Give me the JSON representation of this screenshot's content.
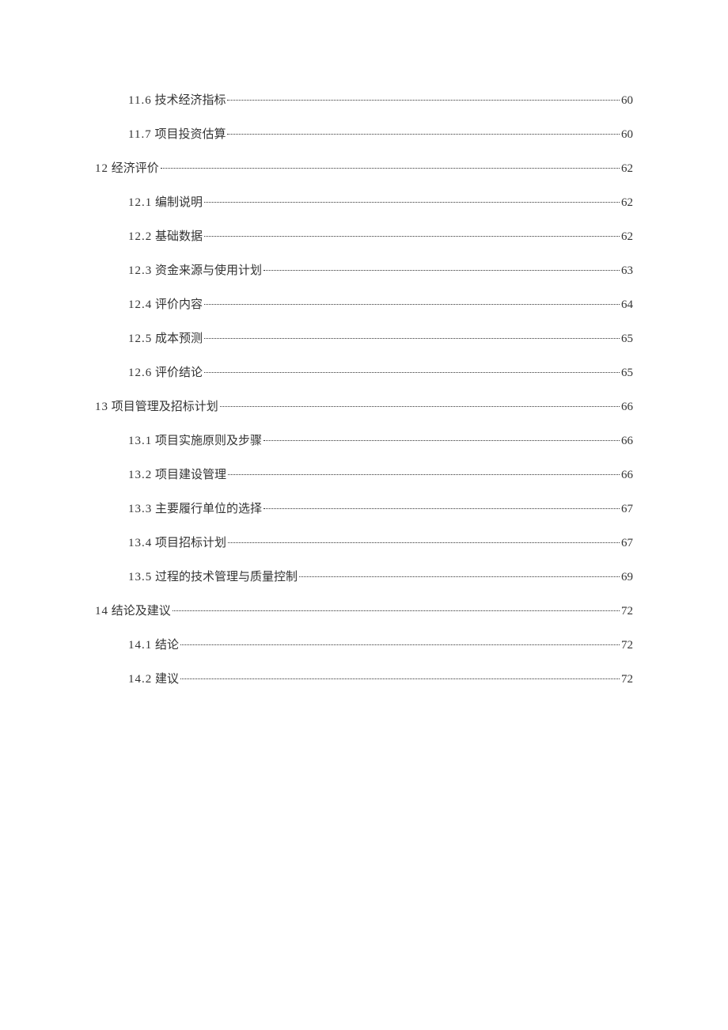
{
  "toc": [
    {
      "level": 2,
      "num": "11.6",
      "title": "技术经济指标",
      "page": "60"
    },
    {
      "level": 2,
      "num": "11.7",
      "title": "项目投资估算",
      "page": "60"
    },
    {
      "level": 1,
      "num": "12",
      "title": "经济评价",
      "page": "62"
    },
    {
      "level": 2,
      "num": "12.1",
      "title": "编制说明",
      "page": "62"
    },
    {
      "level": 2,
      "num": "12.2",
      "title": "基础数据",
      "page": "62"
    },
    {
      "level": 2,
      "num": "12.3",
      "title": "资金来源与使用计划",
      "page": "63"
    },
    {
      "level": 2,
      "num": "12.4",
      "title": "评价内容",
      "page": "64"
    },
    {
      "level": 2,
      "num": "12.5",
      "title": "成本预测",
      "page": "65"
    },
    {
      "level": 2,
      "num": "12.6",
      "title": "评价结论",
      "page": "65"
    },
    {
      "level": 1,
      "num": "13",
      "title": "项目管理及招标计划",
      "page": "66"
    },
    {
      "level": 2,
      "num": "13.1",
      "title": "项目实施原则及步骤",
      "page": "66"
    },
    {
      "level": 2,
      "num": "13.2",
      "title": "项目建设管理",
      "page": "66"
    },
    {
      "level": 2,
      "num": "13.3",
      "title": "主要履行单位的选择",
      "page": "67"
    },
    {
      "level": 2,
      "num": "13.4",
      "title": "项目招标计划",
      "page": "67"
    },
    {
      "level": 2,
      "num": "13.5",
      "title": "过程的技术管理与质量控制",
      "page": "69"
    },
    {
      "level": 1,
      "num": "14",
      "title": "结论及建议",
      "page": "72"
    },
    {
      "level": 2,
      "num": "14.1",
      "title": "结论",
      "page": "72"
    },
    {
      "level": 2,
      "num": "14.2",
      "title": "建议",
      "page": "72"
    }
  ]
}
